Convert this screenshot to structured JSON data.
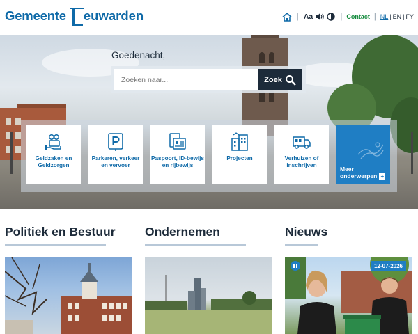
{
  "header": {
    "logo_word1": "Gemeente",
    "logo_word2": "euwarden",
    "home_icon": "home-icon",
    "text_size_label": "Aa",
    "contact_label": "Contact",
    "languages": [
      "NL",
      "EN",
      "FY"
    ],
    "active_language": "NL",
    "colors": {
      "brand": "#0f6aa8",
      "contact": "#138a3c"
    }
  },
  "hero": {
    "greeting": "Goedenacht,",
    "search": {
      "placeholder": "Zoeken naar...",
      "button_label": "Zoek"
    },
    "tiles": [
      {
        "label": "Geldzaken en Geldzorgen",
        "icon": "money-hand-icon"
      },
      {
        "label": "Parkeren, verkeer en vervoer",
        "icon": "parking-icon"
      },
      {
        "label": "Paspoort, ID-bewijs en rijbewijs",
        "icon": "id-card-icon"
      },
      {
        "label": "Projecten",
        "icon": "building-project-icon"
      },
      {
        "label": "Verhuizen of inschrijven",
        "icon": "moving-truck-icon"
      }
    ],
    "more_label": "Meer onderwerpen",
    "colors": {
      "tile_text": "#0f6aa8",
      "more_bg": "#1f7ec4"
    }
  },
  "sections": [
    {
      "title": "Politiek en Bestuur"
    },
    {
      "title": "Ondernemen"
    },
    {
      "title": "Nieuws",
      "date_badge": "12-07-2026"
    }
  ]
}
